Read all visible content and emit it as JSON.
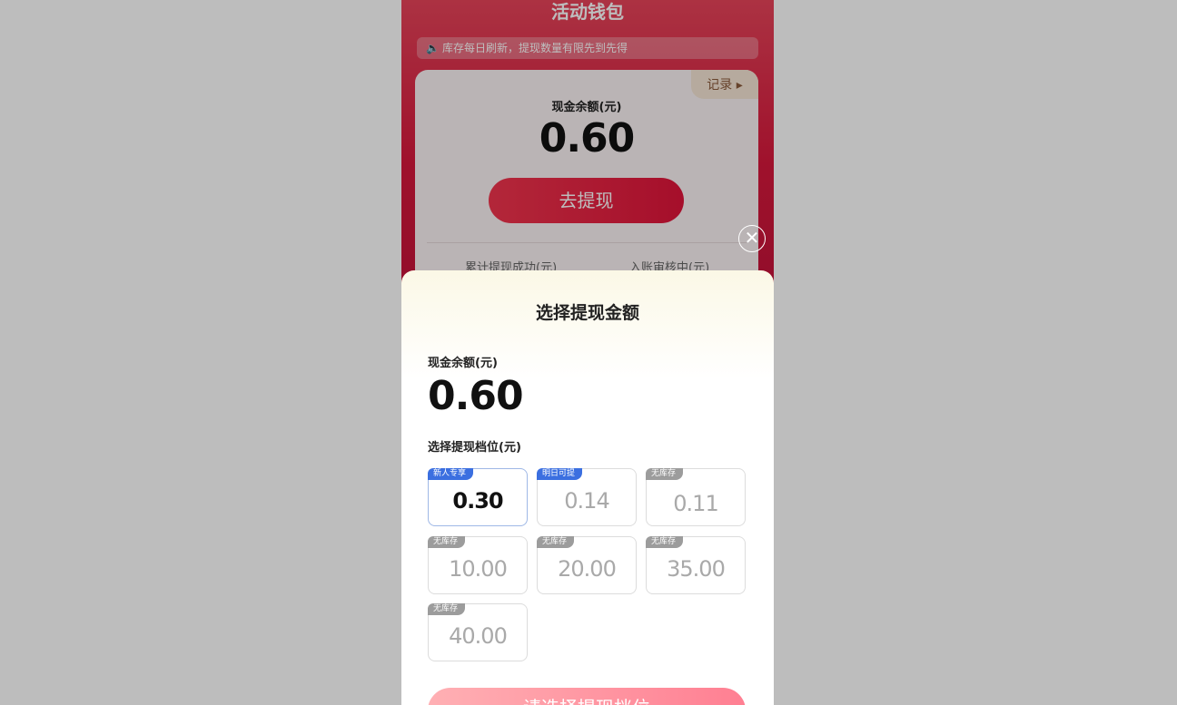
{
  "background": {
    "title": "活动钱包",
    "notice": "库存每日刷新，提现数量有限先到先得",
    "card": {
      "record_label": "记录 ▸",
      "balance_label": "现金余额(元)",
      "balance_value": "0.60",
      "withdraw_button": "去提现",
      "stat_left": "累计提现成功(元)",
      "stat_right": "入账审核中(元)"
    }
  },
  "modal": {
    "close_icon": "✕",
    "title": "选择提现金额",
    "balance_label": "现金余额(元)",
    "balance_value": "0.60",
    "tiers_label": "选择提现档位(元)",
    "tiers": [
      {
        "tag": "新人专享",
        "value": "0.30",
        "selected": true
      },
      {
        "tag": "明日可提",
        "value": "0.14",
        "selected": false
      },
      {
        "tag": "无库存",
        "value": "0.11",
        "selected": false
      },
      {
        "tag": "无库存",
        "value": "10.00",
        "selected": false
      },
      {
        "tag": "无库存",
        "value": "20.00",
        "selected": false
      },
      {
        "tag": "无库存",
        "value": "35.00",
        "selected": false
      },
      {
        "tag": "无库存",
        "value": "40.00",
        "selected": false
      }
    ],
    "confirm_button": "请选择提现档位"
  },
  "colors": {
    "brand_red": "#d7183c",
    "tag_blue": "#3b6fe0",
    "tag_gray": "#9c9c9c"
  },
  "icons": {
    "speaker": "speaker-icon",
    "close": "close-icon",
    "record_arrow": "triangle-right-icon"
  }
}
